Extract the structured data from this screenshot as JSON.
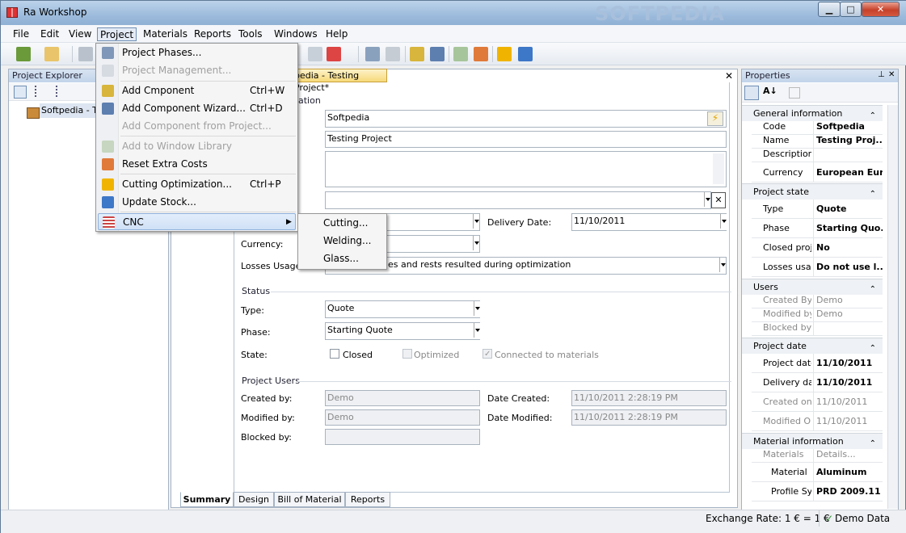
{
  "window": {
    "title": "Ra Workshop",
    "minimize": "▁",
    "maximize": "□",
    "close": "✕",
    "watermark": "SOFTPEDIA"
  },
  "menubar": [
    "File",
    "Edit",
    "View",
    "Project",
    "Materials",
    "Reports",
    "Tools",
    "Windows",
    "Help"
  ],
  "project_explorer": {
    "title": "Project Explorer",
    "tree_item": "Softpedia - Te"
  },
  "document": {
    "tab": "pedia - Testing Project*",
    "close": "✕",
    "general": {
      "partial_heading": "ation",
      "code_value": "Softpedia",
      "name_value": "Testing Project",
      "delivery_label": "Delivery Date:",
      "delivery_value": "11/10/2011",
      "currency_label": "Currency:",
      "losses_label": "Losses Usage",
      "losses_value": "es and rests resulted during optimization"
    },
    "status": {
      "heading": "Status",
      "type_label": "Type:",
      "type_value": "Quote",
      "phase_label": "Phase:",
      "phase_value": "Starting Quote",
      "state_label": "State:",
      "closed": "Closed",
      "optimized": "Optimized",
      "connected": "Connected to materials"
    },
    "users": {
      "heading": "Project Users",
      "created_by_label": "Created by:",
      "created_by": "Demo",
      "modified_by_label": "Modified by:",
      "modified_by": "Demo",
      "blocked_by_label": "Blocked by:",
      "date_created_label": "Date Created:",
      "date_created": "11/10/2011 2:28:19 PM",
      "date_modified_label": "Date Modified:",
      "date_modified": "11/10/2011 2:28:19 PM"
    },
    "bottom_tabs": [
      "Summary",
      "Design",
      "Bill of Material",
      "Reports"
    ]
  },
  "properties": {
    "title": "Properties",
    "pin": "⊥",
    "close": "✕",
    "sections": [
      {
        "title": "General information",
        "rows": [
          [
            "Code",
            "Softpedia"
          ],
          [
            "Name",
            "Testing Proj..."
          ],
          [
            "Description",
            ""
          ],
          [
            "Currency",
            "European Euro"
          ]
        ]
      },
      {
        "title": "Project state",
        "rows": [
          [
            "Type",
            "Quote"
          ],
          [
            "Phase",
            "Starting Quo..."
          ],
          [
            "Closed proje",
            "No"
          ],
          [
            "Losses usag",
            "Do not use l..."
          ]
        ]
      },
      {
        "title": "Users",
        "rows": [
          [
            "Created By",
            "Demo"
          ],
          [
            "Modified by",
            "Demo"
          ],
          [
            "Blocked by",
            ""
          ]
        ]
      },
      {
        "title": "Project date",
        "rows": [
          [
            "Project date",
            "11/10/2011"
          ],
          [
            "Delivery dat",
            "11/10/2011"
          ],
          [
            "Created on",
            "11/10/2011"
          ],
          [
            "Modified On",
            "11/10/2011"
          ]
        ]
      },
      {
        "title": "Material information",
        "rows": [
          [
            "Materials",
            "Details..."
          ],
          [
            "Material",
            "Aluminum"
          ],
          [
            "Profile Sy:",
            "PRD 2009.11"
          ]
        ]
      }
    ],
    "collapse_glyph": "⌃"
  },
  "project_menu": {
    "items": [
      {
        "label": "Project Phases...",
        "shortcut": ""
      },
      {
        "label": "Project Management...",
        "shortcut": ""
      },
      {
        "label": "Add Cmponent",
        "shortcut": "Ctrl+W"
      },
      {
        "label": "Add Component Wizard...",
        "shortcut": "Ctrl+D"
      },
      {
        "label": "Add Component from Project...",
        "shortcut": ""
      },
      {
        "label": "Add to Window Library",
        "shortcut": ""
      },
      {
        "label": "Reset Extra Costs",
        "shortcut": ""
      },
      {
        "label": "Cutting Optimization...",
        "shortcut": "Ctrl+P"
      },
      {
        "label": "Update Stock...",
        "shortcut": ""
      },
      {
        "label": "CNC",
        "shortcut": ""
      }
    ],
    "submenu_arrow": "▶",
    "cnc_submenu": [
      "Cutting...",
      "Welding...",
      "Glass..."
    ]
  },
  "statusbar": {
    "exchange_rate": "Exchange Rate: 1 € = 1 €",
    "mode": "Demo Data",
    "check": "✓"
  }
}
